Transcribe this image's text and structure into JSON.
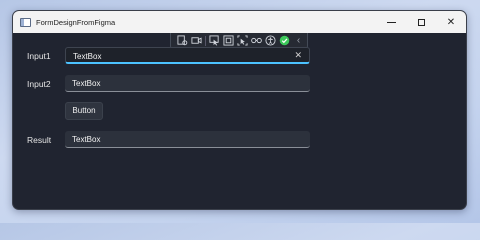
{
  "window": {
    "title": "FormDesignFromFigma",
    "app_icon": "window-icon",
    "caption_buttons": [
      "minimize-icon",
      "maximize-icon",
      "close-icon"
    ],
    "close_glyph": "✕"
  },
  "debug_toolbar": {
    "icons": [
      "live-visual-tree-icon",
      "record-icon",
      "select-element-icon",
      "display-layout-adorners-icon",
      "track-focus-icon",
      "binding-failures-icon",
      "accessibility-icon",
      "status-ok-icon",
      "collapse-chevron-icon"
    ],
    "collapse_glyph": "‹"
  },
  "form": {
    "input1_label": "Input1",
    "input1_value": "TextBox",
    "input1_clear": "✕",
    "input2_label": "Input2",
    "input2_value": "TextBox",
    "button_label": "Button",
    "result_label": "Result",
    "result_value": "TextBox"
  },
  "colors": {
    "window_background": "#202430",
    "titlebar": "#f3f3f3",
    "accent_focus": "#4cc2ff",
    "status_ok": "#3cc85a"
  }
}
